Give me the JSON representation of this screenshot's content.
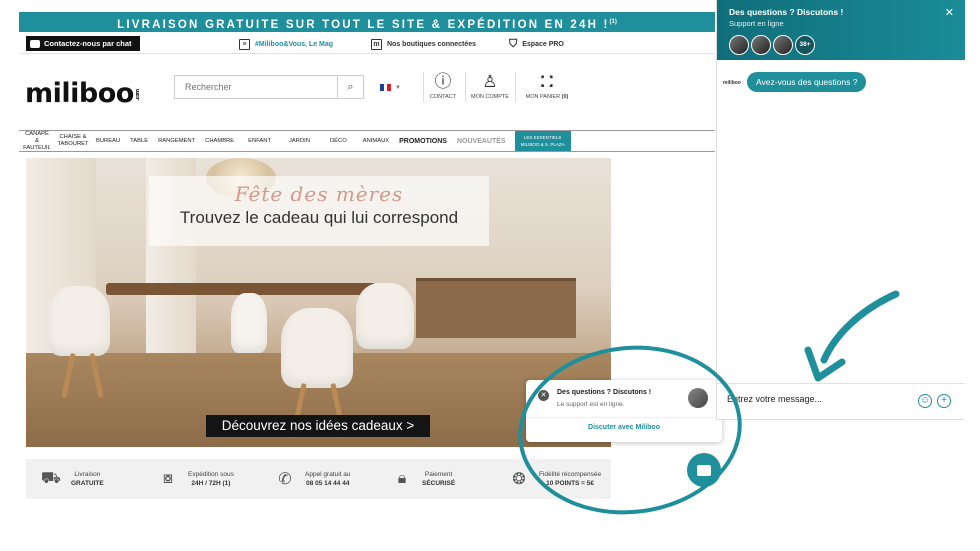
{
  "site": {
    "promo": "LIVRAISON GRATUITE SUR TOUT LE SITE & EXPÉDITION EN 24H !",
    "promo_sup": "(1)",
    "topbar": {
      "chat_label": "Contactez-nous par chat",
      "mag_label": "#Miliboo&Vous, Le Mag",
      "shops_label": "Nos boutiques connectées",
      "pro_label": "Espace PRO"
    },
    "logo": "miliboo",
    "logo_suffix": ".com",
    "search_placeholder": "Rechercher",
    "header_icons": {
      "contact": "CONTACT",
      "account": "MON COMPTE",
      "cart": "MON PANIER",
      "cart_count": "(0)"
    },
    "nav": [
      {
        "label": "CANAPÉ & FAUTEUIL"
      },
      {
        "label": "CHAISE & TABOURET"
      },
      {
        "label": "BUREAU"
      },
      {
        "label": "TABLE"
      },
      {
        "label": "RANGEMENT"
      },
      {
        "label": "CHAMBRE"
      },
      {
        "label": "ENFANT"
      },
      {
        "label": "JARDIN"
      },
      {
        "label": "DÉCO"
      },
      {
        "label": "ANIMAUX"
      },
      {
        "label": "PROMOTIONS"
      },
      {
        "label": "NOUVEAUTÉS"
      },
      {
        "label": "LES ESSENTIELS MILIBOO & S. PLAZA"
      }
    ],
    "hero": {
      "subtitle": "Fête des mères",
      "title": "Trouvez le cadeau qui lui correspond",
      "cta": "Découvrez nos idées cadeaux >"
    },
    "benefits": [
      {
        "line1": "Livraison",
        "line2": "GRATUITE",
        "icon": "delivery-truck-icon"
      },
      {
        "line1": "Expédition sous",
        "line2": "24H / 72H (1)",
        "icon": "package-clock-icon"
      },
      {
        "line1": "Appel gratuit au",
        "line2": "08 05 14 44 44",
        "icon": "phone-icon"
      },
      {
        "line1": "Paiement",
        "line2": "SÉCURISÉ",
        "icon": "lock-icon"
      },
      {
        "line1": "Fidélité récompensée",
        "line2": "10 POINTS = 5€",
        "icon": "award-ribbon-icon"
      }
    ],
    "popup": {
      "title": "Des questions ? Discutons !",
      "subtitle": "Le support est en ligne.",
      "link": "Discuter avec Miliboo"
    }
  },
  "chat_panel": {
    "title": "Des questions ? Discutons !",
    "subtitle": "Support en ligne",
    "agent_count": "38+",
    "brand_mini": "miliboo",
    "message": "Avez-vous des questions ?",
    "input_placeholder": "Entrez votre message..."
  },
  "colors": {
    "accent": "#1f8f9b",
    "header_dark": "#0f6e7a"
  }
}
